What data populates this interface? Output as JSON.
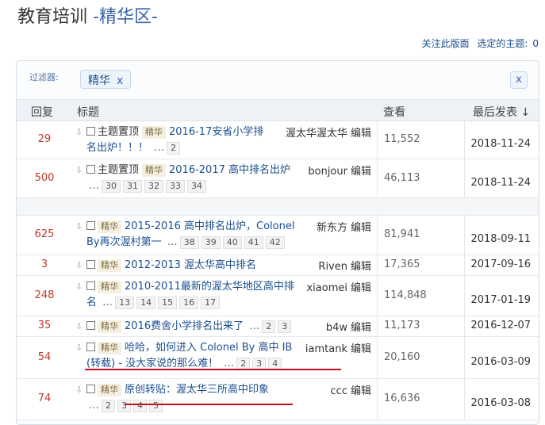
{
  "header": {
    "title": "教育培训",
    "subtitle": "-精华区-",
    "follow_link": "关注此版面",
    "selected_topics_label": "选定的主题:",
    "selected_count": "0"
  },
  "filter": {
    "label": "过滤器:",
    "tag": "精华",
    "tag_remove": "x",
    "clear": "x"
  },
  "columns": {
    "replies": "回复",
    "title": "标题",
    "views": "查看",
    "last_post": "最后发表 ↓"
  },
  "icons": {
    "arrow": "thread-arrow-icon",
    "sort": "sort-down-icon"
  },
  "colors": {
    "link": "#1b4f8f",
    "reply": "#c0392b",
    "annotation": "#c0101a"
  },
  "edit_label": "编辑",
  "threads": [
    {
      "replies": "29",
      "prefix": "主题置顶",
      "badge": "精华",
      "title1": "2016-17安省小学排",
      "author": "渥太华渥太华",
      "title2": "名出炉！！！",
      "pages": [
        "2"
      ],
      "views": "11,552",
      "date": "2018-11-24"
    },
    {
      "replies": "500",
      "prefix": "主题置顶",
      "badge": "精华",
      "title1": "2016-2017 高中排名出炉",
      "author": "bonjour",
      "title2": "",
      "pages": [
        "30",
        "31",
        "32",
        "33",
        "34"
      ],
      "views": "46,113",
      "date": "2018-11-24"
    },
    {
      "replies": "625",
      "prefix": "",
      "badge": "精华",
      "title1": "2015-2016 高中排名出炉，Colonel",
      "author": "新东方",
      "title2": "By再次渥村第一",
      "pages": [
        "38",
        "39",
        "40",
        "41",
        "42"
      ],
      "views": "81,941",
      "date": "2018-09-11"
    },
    {
      "replies": "3",
      "prefix": "",
      "badge": "精华",
      "title1": "2012-2013 渥太华高中排名",
      "author": "Riven",
      "title2": "",
      "pages": [],
      "views": "17,365",
      "date": "2017-09-16"
    },
    {
      "replies": "248",
      "prefix": "",
      "badge": "精华",
      "title1": "2010-2011最新的渥太华地区高中排",
      "author": "xiaomei",
      "title2": "名",
      "pages": [
        "13",
        "14",
        "15",
        "16",
        "17"
      ],
      "views": "114,848",
      "date": "2017-01-19"
    },
    {
      "replies": "35",
      "prefix": "",
      "badge": "精华",
      "title1": "2016费舍小学排名出来了",
      "author": "b4w",
      "title2": "",
      "pages": [
        "2",
        "3"
      ],
      "views": "11,173",
      "date": "2016-12-07"
    },
    {
      "replies": "54",
      "prefix": "",
      "badge": "精华",
      "title1": "哈哈，如何进入 Colonel By 高中 IB",
      "author": "iamtank",
      "title2": "(转载) - 没大家说的那么难！",
      "pages": [
        "2",
        "3",
        "4"
      ],
      "views": "20,160",
      "date": "2016-03-09"
    },
    {
      "replies": "74",
      "prefix": "",
      "badge": "精华",
      "title1": "原创转贴：渥太华三所高中印象",
      "author": "ccc",
      "title2": "",
      "pages": [
        "2",
        "3",
        "4",
        "5"
      ],
      "views": "16,636",
      "date": "2016-03-08"
    }
  ]
}
